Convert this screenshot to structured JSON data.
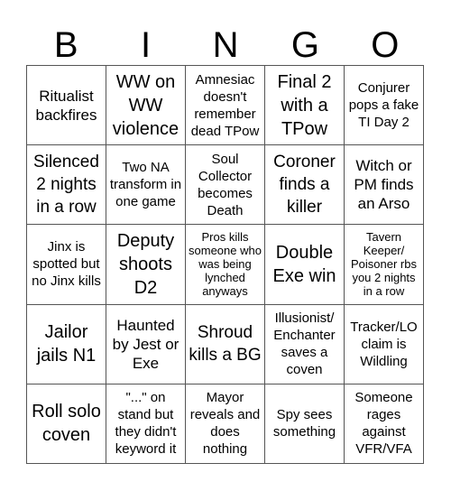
{
  "header": [
    "B",
    "I",
    "N",
    "G",
    "O"
  ],
  "cells": [
    {
      "text": "Ritualist backfires",
      "size": "s3"
    },
    {
      "text": "WW on WW violence",
      "size": "s5"
    },
    {
      "text": "Amnesiac doesn't remember dead TPow",
      "size": "s2"
    },
    {
      "text": "Final 2 with a TPow",
      "size": "s5"
    },
    {
      "text": "Conjurer pops a fake TI Day 2",
      "size": "s2"
    },
    {
      "text": "Silenced 2 nights in a row",
      "size": "s4"
    },
    {
      "text": "Two NA transform in one game",
      "size": "s2"
    },
    {
      "text": "Soul Collector becomes Death",
      "size": "s2"
    },
    {
      "text": "Coroner finds a killer",
      "size": "s4"
    },
    {
      "text": "Witch or PM finds an Arso",
      "size": "s3"
    },
    {
      "text": "Jinx is spotted but no Jinx kills",
      "size": "s2"
    },
    {
      "text": "Deputy shoots D2",
      "size": "s5"
    },
    {
      "text": "Pros kills someone who was being lynched anyways",
      "size": "s1"
    },
    {
      "text": "Double Exe win",
      "size": "s5"
    },
    {
      "text": "Tavern Keeper/ Poisoner rbs you 2 nights in a row",
      "size": "s1"
    },
    {
      "text": "Jailor jails N1",
      "size": "s5"
    },
    {
      "text": "Haunted by Jest or Exe",
      "size": "s3"
    },
    {
      "text": "Shroud kills a BG",
      "size": "s4"
    },
    {
      "text": "Illusionist/ Enchanter saves a coven",
      "size": "s2"
    },
    {
      "text": "Tracker/LO claim is Wildling",
      "size": "s2"
    },
    {
      "text": "Roll solo coven",
      "size": "s5"
    },
    {
      "text": "\"...\" on stand but they didn't keyword it",
      "size": "s2"
    },
    {
      "text": "Mayor reveals and does nothing",
      "size": "s2"
    },
    {
      "text": "Spy sees something",
      "size": "s2"
    },
    {
      "text": "Someone rages against VFR/VFA",
      "size": "s2"
    }
  ]
}
